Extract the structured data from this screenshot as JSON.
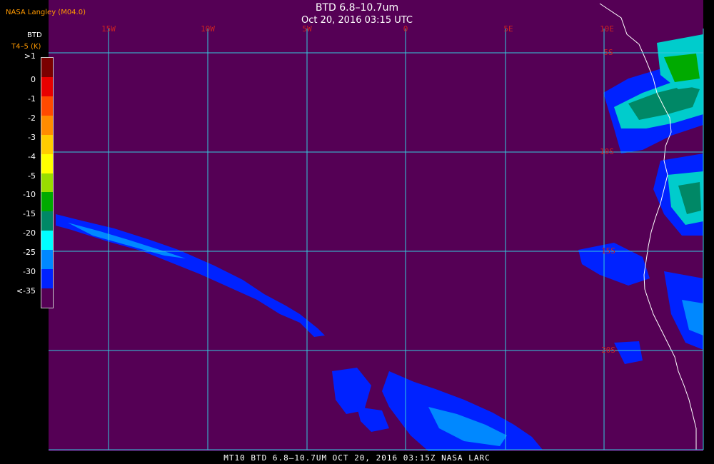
{
  "header": {
    "source": "NASA Langley (M04.0)",
    "title": "BTD 6.8–10.7um",
    "time": "Oct 20, 2016 03:15 UTC"
  },
  "legend": {
    "title": "BTD",
    "units": "T4–5 (K)",
    "bins": [
      {
        "label": ">1",
        "color": "#7a0000"
      },
      {
        "label": "0",
        "color": "#e80000"
      },
      {
        "label": "-1",
        "color": "#ff4a00"
      },
      {
        "label": "-2",
        "color": "#ff8c00"
      },
      {
        "label": "-3",
        "color": "#ffcc00"
      },
      {
        "label": "-4",
        "color": "#ffff00"
      },
      {
        "label": "-5",
        "color": "#99dd00"
      },
      {
        "label": "-10",
        "color": "#00aa00"
      },
      {
        "label": "-15",
        "color": "#008866"
      },
      {
        "label": "-20",
        "color": "#00ffff"
      },
      {
        "label": "-25",
        "color": "#0088ff"
      },
      {
        "label": "-30",
        "color": "#0022ff"
      },
      {
        "label": "<-35",
        "color": "#550055"
      }
    ]
  },
  "map": {
    "background_color": "#550055",
    "grid_color": "#33ccdd",
    "lon_labels": [
      "15W",
      "10W",
      "5W",
      "0",
      "5E",
      "10E"
    ],
    "lat_labels": [
      "5S",
      "10S",
      "15S",
      "20S"
    ]
  },
  "footer": {
    "text": "MT10  BTD 6.8–10.7UM   OCT 20, 2016 03:15Z   NASA LARC"
  }
}
